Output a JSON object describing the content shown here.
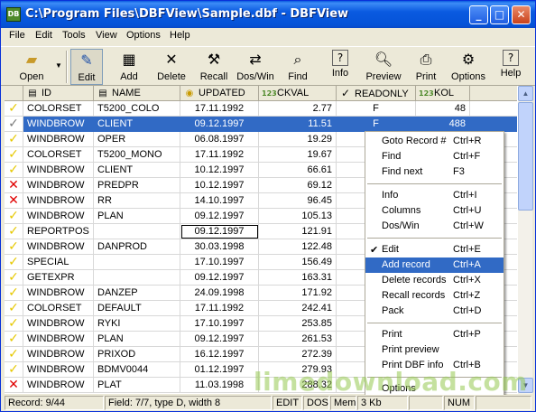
{
  "window": {
    "title": "C:\\Program Files\\DBFView\\Sample.dbf - DBFView",
    "icon": "app-icon",
    "minimize": "_",
    "maximize": "□",
    "close": "✕"
  },
  "menu": [
    "File",
    "Edit",
    "Tools",
    "View",
    "Options",
    "Help"
  ],
  "toolbar": {
    "open": "Open",
    "edit": "Edit",
    "add": "Add",
    "delete": "Delete",
    "recall": "Recall",
    "doswin": "Dos/Win",
    "find": "Find",
    "info": "Info",
    "preview": "Preview",
    "print": "Print",
    "options": "Options",
    "help": "Help"
  },
  "columns": [
    {
      "name": "ID",
      "type_icon": "text-field-icon"
    },
    {
      "name": "NAME",
      "type_icon": "text-field-icon"
    },
    {
      "name": "UPDATED",
      "type_icon": "date-field-icon"
    },
    {
      "name": "CKVAL",
      "type_icon": "numeric-field-icon",
      "type_text": "123"
    },
    {
      "name": "READONLY",
      "type_icon": "logical-field-icon"
    },
    {
      "name": "KOL",
      "type_icon": "numeric-field-icon",
      "type_text": "123"
    }
  ],
  "rows": [
    {
      "mark": "ok",
      "id": "COLORSET",
      "name": "T5200_COLO",
      "updated": "17.11.1992",
      "ckval": "2.77",
      "readonly": "F",
      "kol": "48"
    },
    {
      "mark": "current",
      "id": "WINDBROW",
      "name": "CLIENT",
      "updated": "09.12.1997",
      "ckval": "11.51",
      "readonly": "F",
      "kol": "488"
    },
    {
      "mark": "ok",
      "id": "WINDBROW",
      "name": "OPER",
      "updated": "06.08.1997",
      "ckval": "19.29",
      "readonly": "",
      "kol": ""
    },
    {
      "mark": "ok",
      "id": "COLORSET",
      "name": "T5200_MONO",
      "updated": "17.11.1992",
      "ckval": "19.67",
      "readonly": "",
      "kol": ""
    },
    {
      "mark": "ok",
      "id": "WINDBROW",
      "name": "CLIENT",
      "updated": "10.12.1997",
      "ckval": "66.61",
      "readonly": "",
      "kol": ""
    },
    {
      "mark": "deleted",
      "id": "WINDBROW",
      "name": "PREDPR",
      "updated": "10.12.1997",
      "ckval": "69.12",
      "readonly": "",
      "kol": ""
    },
    {
      "mark": "deleted",
      "id": "WINDBROW",
      "name": "RR",
      "updated": "14.10.1997",
      "ckval": "96.45",
      "readonly": "",
      "kol": ""
    },
    {
      "mark": "ok",
      "id": "WINDBROW",
      "name": "PLAN",
      "updated": "09.12.1997",
      "ckval": "105.13",
      "readonly": "",
      "kol": ""
    },
    {
      "mark": "ok",
      "id": "REPORTPOS",
      "name": "",
      "updated": "09.12.1997",
      "ckval": "121.91",
      "readonly": "",
      "kol": ""
    },
    {
      "mark": "ok",
      "id": "WINDBROW",
      "name": "DANPROD",
      "updated": "30.03.1998",
      "ckval": "122.48",
      "readonly": "",
      "kol": ""
    },
    {
      "mark": "ok",
      "id": "SPECIAL",
      "name": "",
      "updated": "17.10.1997",
      "ckval": "156.49",
      "readonly": "",
      "kol": ""
    },
    {
      "mark": "ok",
      "id": "GETEXPR",
      "name": "",
      "updated": "09.12.1997",
      "ckval": "163.31",
      "readonly": "",
      "kol": ""
    },
    {
      "mark": "ok",
      "id": "WINDBROW",
      "name": "DANZEP",
      "updated": "24.09.1998",
      "ckval": "171.92",
      "readonly": "",
      "kol": ""
    },
    {
      "mark": "ok",
      "id": "COLORSET",
      "name": "DEFAULT",
      "updated": "17.11.1992",
      "ckval": "242.41",
      "readonly": "",
      "kol": ""
    },
    {
      "mark": "ok",
      "id": "WINDBROW",
      "name": "RYKI",
      "updated": "17.10.1997",
      "ckval": "253.85",
      "readonly": "",
      "kol": ""
    },
    {
      "mark": "ok",
      "id": "WINDBROW",
      "name": "PLAN",
      "updated": "09.12.1997",
      "ckval": "261.53",
      "readonly": "",
      "kol": ""
    },
    {
      "mark": "ok",
      "id": "WINDBROW",
      "name": "PRIXOD",
      "updated": "16.12.1997",
      "ckval": "272.39",
      "readonly": "",
      "kol": ""
    },
    {
      "mark": "ok",
      "id": "WINDBROW",
      "name": "BDMV0044",
      "updated": "01.12.1997",
      "ckval": "279.93",
      "readonly": "",
      "kol": ""
    },
    {
      "mark": "deleted",
      "id": "WINDBROW",
      "name": "PLAT",
      "updated": "11.03.1998",
      "ckval": "288.32",
      "readonly": "",
      "kol": ""
    }
  ],
  "context_menu": [
    {
      "label": "Goto Record #",
      "shortcut": "Ctrl+R"
    },
    {
      "label": "Find",
      "shortcut": "Ctrl+F"
    },
    {
      "label": "Find next",
      "shortcut": "F3"
    },
    {
      "separator": true
    },
    {
      "label": "Info",
      "shortcut": "Ctrl+I"
    },
    {
      "label": "Columns",
      "shortcut": "Ctrl+U"
    },
    {
      "label": "Dos/Win",
      "shortcut": "Ctrl+W"
    },
    {
      "separator": true
    },
    {
      "label": "Edit",
      "shortcut": "Ctrl+E",
      "checked": true
    },
    {
      "label": "Add record",
      "shortcut": "Ctrl+A",
      "highlighted": true
    },
    {
      "label": "Delete records",
      "shortcut": "Ctrl+X"
    },
    {
      "label": "Recall records",
      "shortcut": "Ctrl+Z"
    },
    {
      "label": "Pack",
      "shortcut": "Ctrl+D"
    },
    {
      "separator": true
    },
    {
      "label": "Print",
      "shortcut": "Ctrl+P"
    },
    {
      "label": "Print preview",
      "shortcut": ""
    },
    {
      "label": "Print DBF info",
      "shortcut": "Ctrl+B"
    },
    {
      "separator": true
    },
    {
      "label": "Options",
      "shortcut": ""
    }
  ],
  "status": {
    "record": "Record: 9/44",
    "field": "Field: 7/7, type D, width 8",
    "mode": "EDIT",
    "codepage": "DOS",
    "mem_label": "Mem",
    "mem": "3 Kb",
    "blank": "",
    "numlock": "NUM"
  },
  "watermark": "limedownload.com",
  "colors": {
    "title_bar": "#0a5ae0",
    "selection": "#316ac5",
    "ok_mark": "#e6c800",
    "deleted_mark": "#e00000"
  }
}
